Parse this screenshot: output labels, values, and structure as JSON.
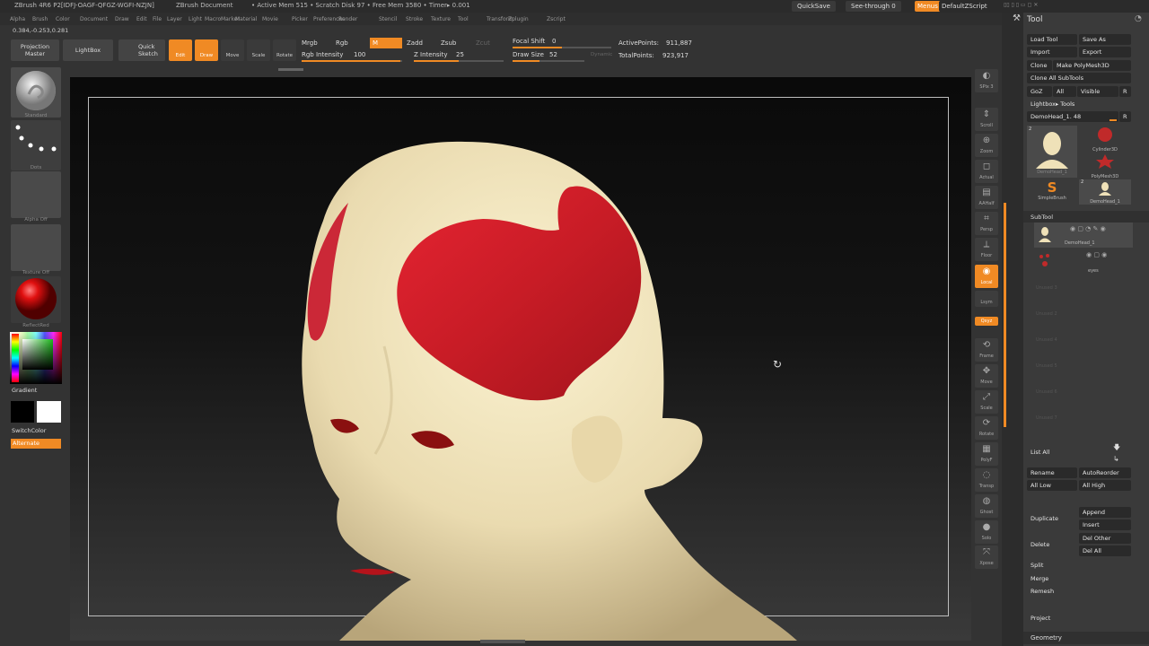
{
  "titlebar": {
    "app": "ZBrush 4R6 P2[IDFJ-OAGF-QFGZ-WGFI-NZJN]",
    "doc": "ZBrush Document",
    "mem": "• Active Mem 515 • Scratch Disk 97 • Free Mem 3580 • Timer▸ 0.001",
    "quicksave": "QuickSave",
    "seethrough": "See-through  0",
    "menus": "Menus",
    "script": "DefaultZScript"
  },
  "menubar": [
    "Alpha",
    "Brush",
    "Color",
    "Document",
    "Draw",
    "Edit",
    "File",
    "Layer",
    "Light",
    "Macro",
    "Marker",
    "Material",
    "Movie",
    "Picker",
    "Preferences",
    "Render",
    "Stencil",
    "Stroke",
    "Texture",
    "Tool",
    "Transform",
    "Zplugin",
    "Zscript"
  ],
  "coords": "0.384,-0.253,0.281",
  "toolbar": {
    "projection_master": "Projection Master",
    "lightbox": "LightBox",
    "quick_sketch": "Quick Sketch",
    "edit": "Edit",
    "draw": "Draw",
    "move": "Move",
    "scale": "Scale",
    "rotate": "Rotate",
    "mrgb": "Mrgb",
    "rgb": "Rgb",
    "m": "M",
    "zadd": "Zadd",
    "zsub": "Zsub",
    "zcut": "Zcut",
    "rgb_intensity_label": "Rgb Intensity",
    "rgb_intensity": "100",
    "z_intensity_label": "Z Intensity",
    "z_intensity": "25",
    "focal_shift_label": "Focal Shift",
    "focal_shift": "0",
    "draw_size_label": "Draw Size",
    "draw_size": "52",
    "dynamic": "Dynamic",
    "active_points_label": "ActivePoints:",
    "active_points": "911,887",
    "total_points_label": "TotalPoints:",
    "total_points": "923,917"
  },
  "leftshelf": {
    "brush": "Standard",
    "stroke": "Dots",
    "alpha": "Alpha Off",
    "texture": "Texture Off",
    "material": "ReflectRed",
    "gradient": "Gradient",
    "switchcolor": "SwitchColor",
    "alternate": "Alternate"
  },
  "rightshelf": [
    "SPix 3",
    "Scroll",
    "Zoom",
    "Actual",
    "AAHalf",
    "Persp",
    "Floor",
    "Local",
    "Lsym",
    "Qxyz",
    "Frame",
    "Move",
    "Scale",
    "Rotate",
    "PolyF",
    "Transp",
    "Ghost",
    "Solo",
    "Xpose"
  ],
  "toolpanel": {
    "title": "Tool",
    "load_tool": "Load Tool",
    "save_as": "Save As",
    "import": "Import",
    "export": "Export",
    "clone": "Clone",
    "make_polymesh": "Make PolyMesh3D",
    "clone_all": "Clone  All SubTools",
    "goz": "GoZ",
    "all": "All",
    "visible": "Visible",
    "r": "R",
    "lightbox_tools": "Lightbox▸ Tools",
    "current_tool": "DemoHead_1. 48",
    "thumbs": [
      "DemoHead_1",
      "Cylinder3D",
      "PolyMesh3D",
      "SimpleBrush",
      "DemoHead_1"
    ],
    "thumb_badge_1": "2",
    "thumb_badge_2": "2",
    "subtool_title": "SubTool",
    "subtools": [
      "DemoHead_1",
      "eyes",
      "Unused 3",
      "Unused 2",
      "Unused 4",
      "Unused 5",
      "Unused 6",
      "Unused 7"
    ],
    "list_all": "List All",
    "rename": "Rename",
    "autoreorder": "AutoReorder",
    "all_low": "All Low",
    "all_high": "All High",
    "append": "Append",
    "duplicate": "Duplicate",
    "insert": "Insert",
    "del_other": "Del Other",
    "delete": "Delete",
    "del_all": "Del All",
    "split": "Split",
    "merge": "Merge",
    "remesh": "Remesh",
    "project": "Project",
    "geometry": "Geometry"
  },
  "colors": {
    "accent": "#f08a24",
    "skin": "#f2e6bf",
    "paint": "#d11f2a"
  }
}
